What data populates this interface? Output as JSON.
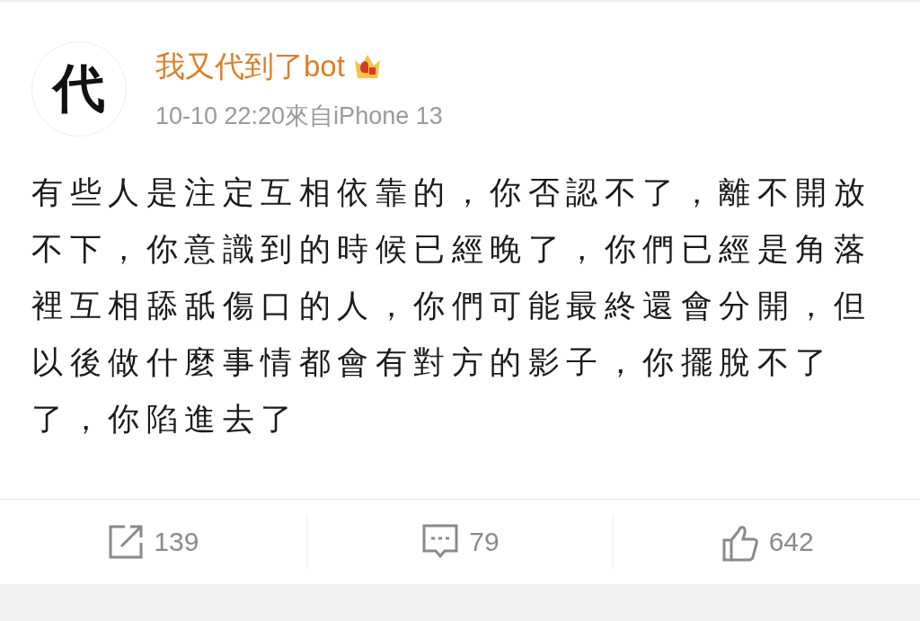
{
  "post": {
    "avatar_text": "代",
    "author": "我又代到了bot",
    "time": "10-10 22:20來自iPhone 13",
    "text": "有些人是注定互相依靠的，你否認不了，離不開放不下，你意識到的時候已經晚了，你們已經是角落裡互相舔舐傷口的人，你們可能最終還會分開，但以後做什麼事情都會有對方的影子，你擺脫不了了，你陷進去了"
  },
  "actions": [
    {
      "kind": "repost",
      "count": "139"
    },
    {
      "kind": "comment",
      "count": "79"
    },
    {
      "kind": "like",
      "count": "642"
    }
  ]
}
